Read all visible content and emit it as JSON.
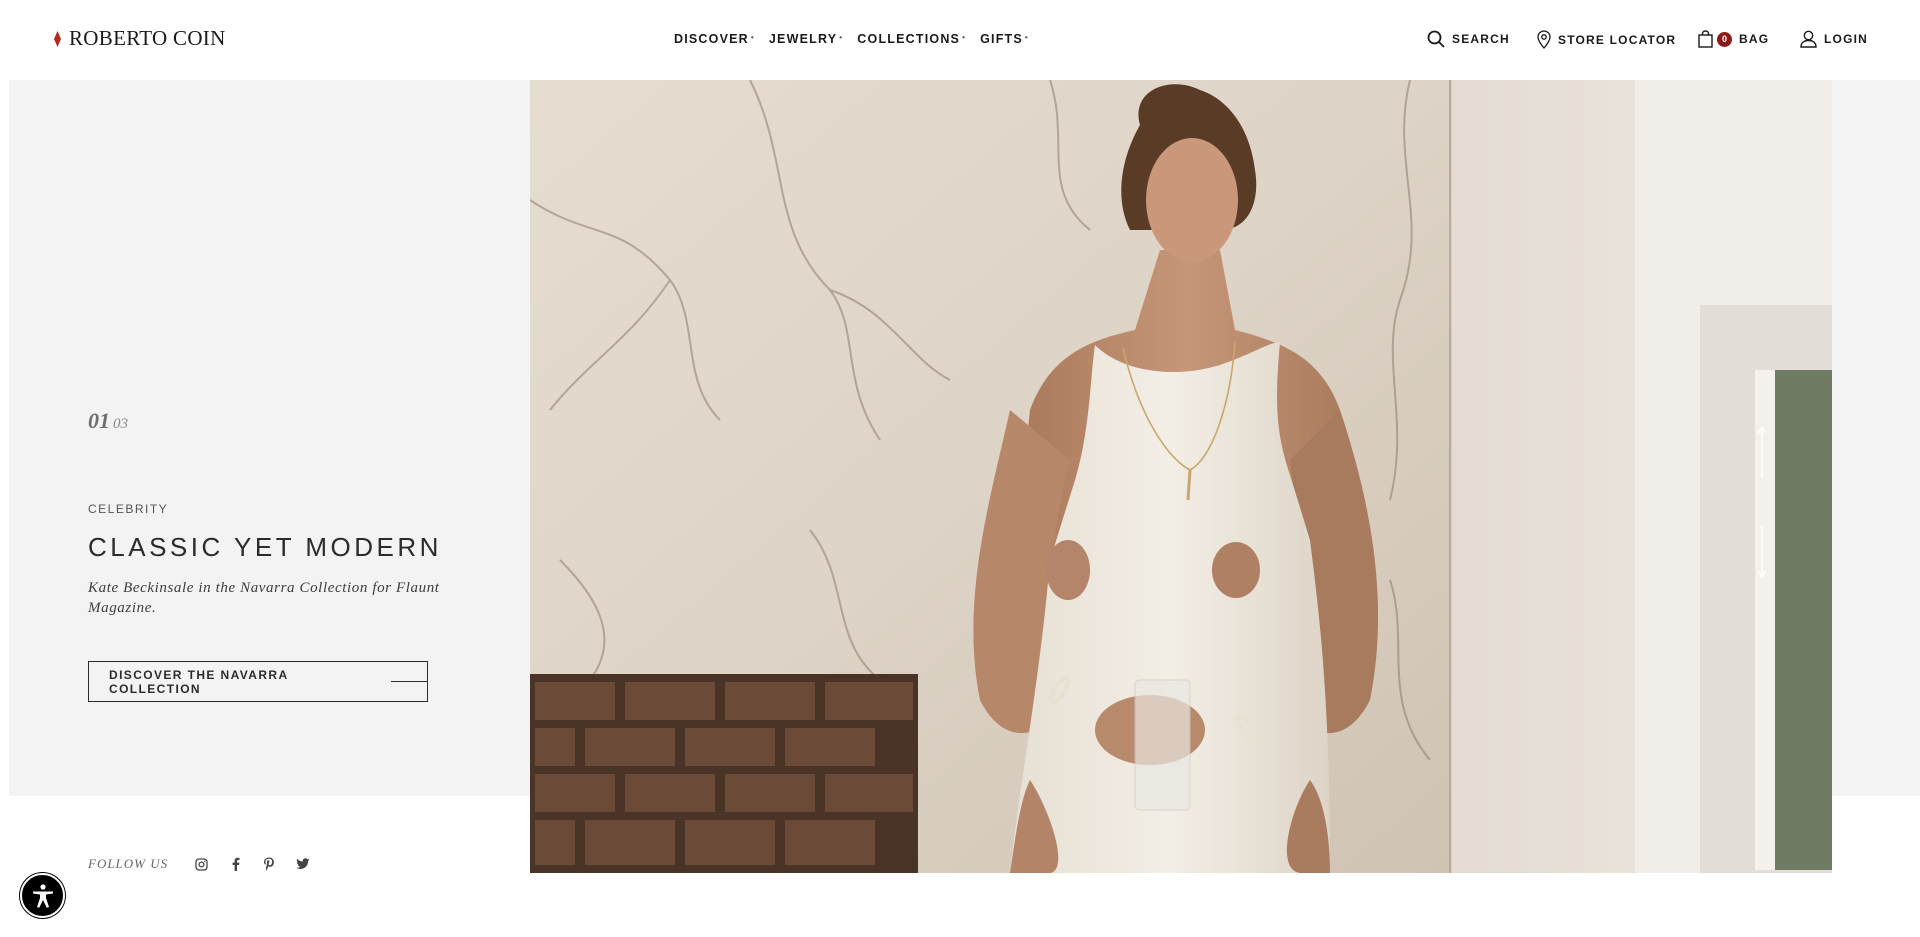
{
  "header": {
    "brand": "ROBERTO COIN",
    "nav": [
      {
        "label": "DISCOVER"
      },
      {
        "label": "JEWELRY"
      },
      {
        "label": "COLLECTIONS"
      },
      {
        "label": "GIFTS"
      }
    ],
    "search_label": "SEARCH",
    "store_locator_label": "STORE LOCATOR",
    "bag_count": "0",
    "bag_label": "BAG",
    "login_label": "LOGIN"
  },
  "hero": {
    "current_slide": "01",
    "total_slides": "03",
    "eyebrow": "CELEBRITY",
    "title": "CLASSIC YET MODERN",
    "caption": "Kate Beckinsale in the Navarra Collection for Flaunt Magazine.",
    "cta_label": "DISCOVER THE NAVARRA COLLECTION"
  },
  "footer": {
    "follow_label": "FOLLOW US",
    "social_icons": [
      "instagram-icon",
      "facebook-icon",
      "pinterest-icon",
      "twitter-icon"
    ]
  },
  "colors": {
    "accent": "#8c1a1a",
    "text": "#1a1a1a",
    "panel_bg": "#f3f3f3"
  }
}
